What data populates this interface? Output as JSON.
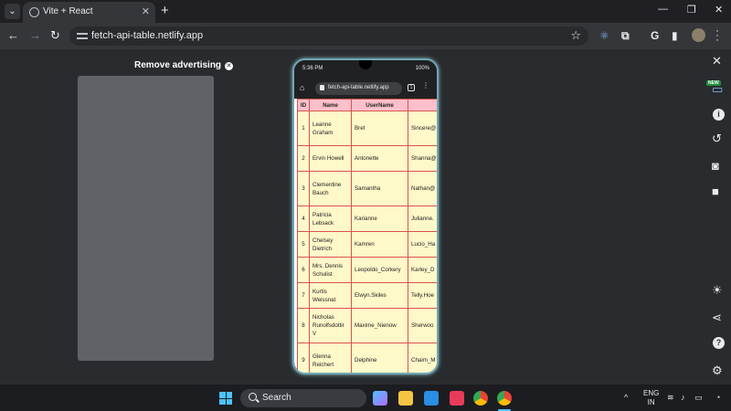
{
  "browser": {
    "tab_title": "Vite + React",
    "url": "fetch-api-table.netlify.app"
  },
  "page": {
    "remove_ad_label": "Remove advertising"
  },
  "phone": {
    "status_time": "5:36 PM",
    "battery": "100%",
    "url": "fetch-api-table.netlify.app",
    "tab_count": "1",
    "table": {
      "headers": [
        "ID",
        "Name",
        "UserName"
      ],
      "rows": [
        {
          "id": "1",
          "name": "Leanne Graham",
          "username": "Bret",
          "email": "Sincere@"
        },
        {
          "id": "2",
          "name": "Ervin Howell",
          "username": "Antonette",
          "email": "Shanna@"
        },
        {
          "id": "3",
          "name": "Clementine Bauch",
          "username": "Samantha",
          "email": "Nathan@"
        },
        {
          "id": "4",
          "name": "Patricia Lebsack",
          "username": "Karianne",
          "email": "Julianne."
        },
        {
          "id": "5",
          "name": "Chelsey Dietrich",
          "username": "Kamren",
          "email": "Lucio_Ha"
        },
        {
          "id": "6",
          "name": "Mrs. Dennis Schulist",
          "username": "Leopoldo_Corkery",
          "email": "Karley_D"
        },
        {
          "id": "7",
          "name": "Kurtis Weissnat",
          "username": "Elwyn.Skiles",
          "email": "Telly.Hoe"
        },
        {
          "id": "8",
          "name": "Nicholas Runolfsdottir V",
          "username": "Maxime_Nienow",
          "email": "Sherwoo"
        },
        {
          "id": "9",
          "name": "Glenna Reichert",
          "username": "Delphine",
          "email": "Chaim_M"
        }
      ]
    }
  },
  "side_panel": {
    "new_badge": "NEW"
  },
  "taskbar": {
    "search_label": "Search",
    "lang_line1": "ENG",
    "lang_line2": "IN"
  },
  "colors": {
    "table_header_bg": "#ffc0cb",
    "table_cell_bg": "#fff8c9",
    "table_border": "#d9534f",
    "phone_frame": "#6ea8b4"
  }
}
